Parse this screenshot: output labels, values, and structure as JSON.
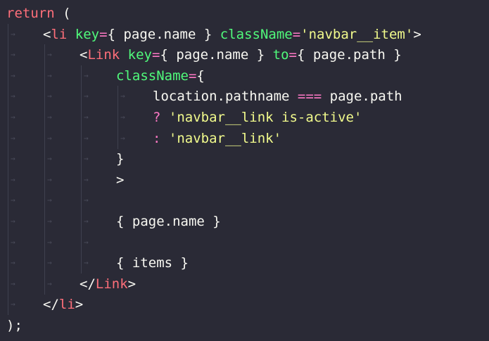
{
  "editor": {
    "theme_colors": {
      "background": "#2a2a36",
      "keyword": "#ff6f7a",
      "attribute": "#50fa7b",
      "string": "#f1fa8c",
      "operator": "#ff79c6",
      "text": "#f8f8f2"
    },
    "lines": [
      {
        "indent": 0,
        "tokens": [
          {
            "t": "return",
            "c": "kw"
          },
          {
            "t": " (",
            "c": "punc"
          }
        ]
      },
      {
        "indent": 1,
        "tokens": [
          {
            "t": "<",
            "c": "punc"
          },
          {
            "t": "li",
            "c": "tag"
          },
          {
            "t": " ",
            "c": "plain"
          },
          {
            "t": "key",
            "c": "attr"
          },
          {
            "t": "=",
            "c": "op"
          },
          {
            "t": "{ page.name }",
            "c": "plain"
          },
          {
            "t": " ",
            "c": "plain"
          },
          {
            "t": "className",
            "c": "attr"
          },
          {
            "t": "=",
            "c": "op"
          },
          {
            "t": "'navbar__item'",
            "c": "str"
          },
          {
            "t": ">",
            "c": "punc"
          }
        ]
      },
      {
        "indent": 2,
        "tokens": [
          {
            "t": "<",
            "c": "punc"
          },
          {
            "t": "Link",
            "c": "tag"
          },
          {
            "t": " ",
            "c": "plain"
          },
          {
            "t": "key",
            "c": "attr"
          },
          {
            "t": "=",
            "c": "op"
          },
          {
            "t": "{ page.name }",
            "c": "plain"
          },
          {
            "t": " ",
            "c": "plain"
          },
          {
            "t": "to",
            "c": "attr"
          },
          {
            "t": "=",
            "c": "op"
          },
          {
            "t": "{ page.path }",
            "c": "plain"
          }
        ]
      },
      {
        "indent": 3,
        "tokens": [
          {
            "t": "className",
            "c": "attr"
          },
          {
            "t": "=",
            "c": "op"
          },
          {
            "t": "{",
            "c": "punc"
          }
        ]
      },
      {
        "indent": 4,
        "tokens": [
          {
            "t": "location.pathname ",
            "c": "plain"
          },
          {
            "t": "===",
            "c": "op"
          },
          {
            "t": " page.path",
            "c": "plain"
          }
        ]
      },
      {
        "indent": 4,
        "tokens": [
          {
            "t": "? ",
            "c": "op"
          },
          {
            "t": "'navbar__link is-active'",
            "c": "str"
          }
        ]
      },
      {
        "indent": 4,
        "tokens": [
          {
            "t": ": ",
            "c": "op"
          },
          {
            "t": "'navbar__link'",
            "c": "str"
          }
        ]
      },
      {
        "indent": 3,
        "tokens": [
          {
            "t": "}",
            "c": "punc"
          }
        ]
      },
      {
        "indent": 3,
        "tokens": [
          {
            "t": ">",
            "c": "punc"
          }
        ]
      },
      {
        "indent": 3,
        "tokens": []
      },
      {
        "indent": 3,
        "tokens": [
          {
            "t": "{ page.name }",
            "c": "plain"
          }
        ]
      },
      {
        "indent": 3,
        "tokens": []
      },
      {
        "indent": 3,
        "tokens": [
          {
            "t": "{ items }",
            "c": "plain"
          }
        ]
      },
      {
        "indent": 2,
        "tokens": [
          {
            "t": "</",
            "c": "punc"
          },
          {
            "t": "Link",
            "c": "tag"
          },
          {
            "t": ">",
            "c": "punc"
          }
        ]
      },
      {
        "indent": 1,
        "tokens": [
          {
            "t": "</",
            "c": "punc"
          },
          {
            "t": "li",
            "c": "tag"
          },
          {
            "t": ">",
            "c": "punc"
          }
        ]
      },
      {
        "indent": 0,
        "tokens": [
          {
            "t": ");",
            "c": "punc"
          }
        ]
      }
    ]
  }
}
